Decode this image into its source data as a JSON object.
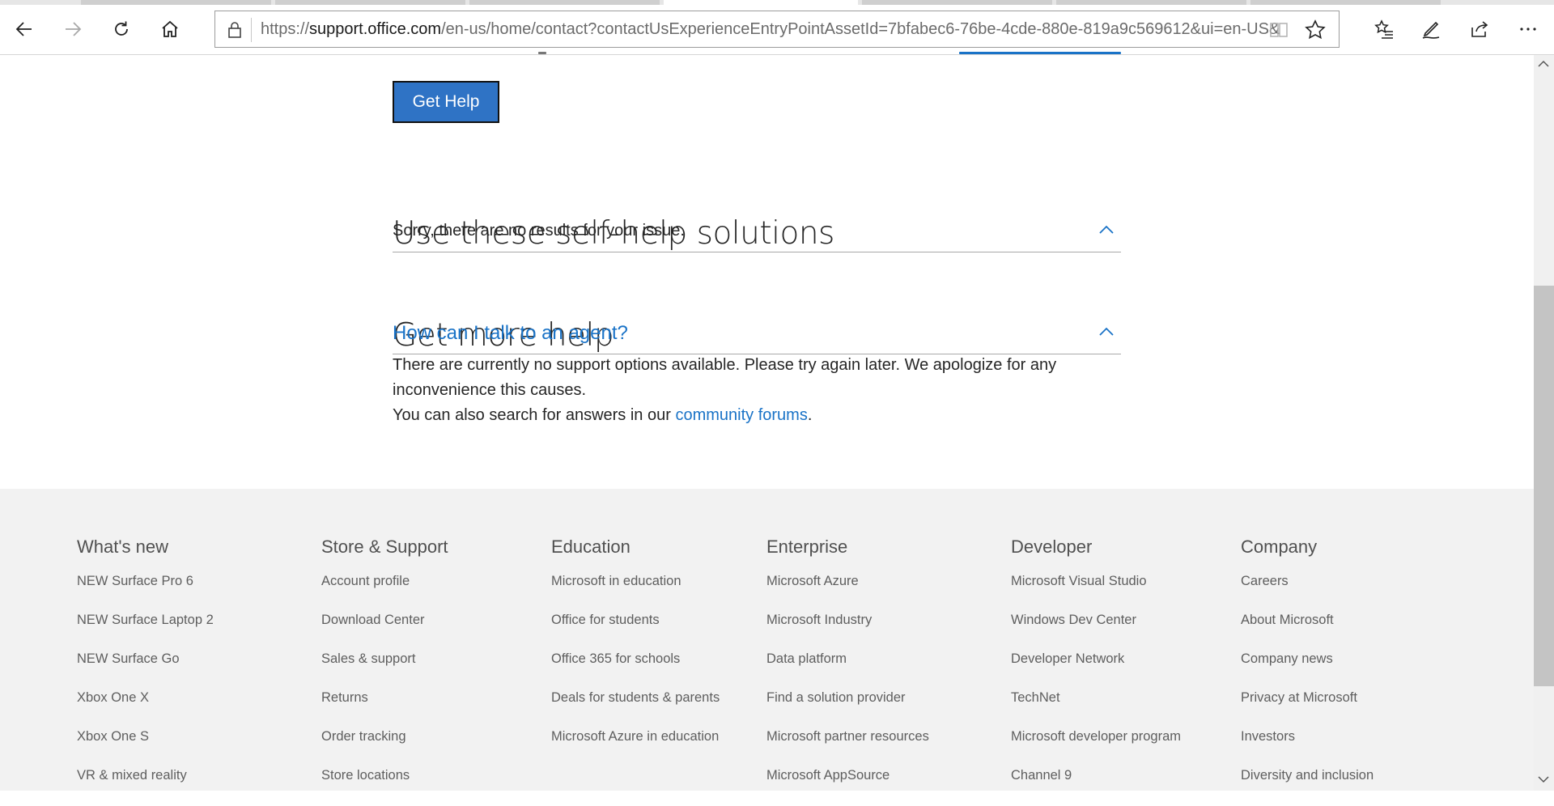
{
  "browser": {
    "url_prefix": "https://",
    "url_host": "support.office.com",
    "url_rest": "/en-us/home/contact?contactUsExperienceEntryPointAssetId=7bfabec6-76be-4cde-880e-819a9c569612&ui=en-US&",
    "icons": [
      "back-arrow-icon",
      "forward-arrow-icon",
      "refresh-icon",
      "home-icon",
      "lock-icon",
      "reading-view-icon",
      "favorite-star-icon",
      "favorites-list-icon",
      "pen-icon",
      "share-icon",
      "more-icon"
    ]
  },
  "main": {
    "get_help_button": "Get Help",
    "self_help": {
      "heading": "Use these self-help solutions",
      "no_results": "Sorry, there are no results for your issue."
    },
    "more_help": {
      "heading": "Get more help",
      "agent_link": "How can I talk to an agent?",
      "no_options_line1": "There are currently no support options available. Please try again later. We apologize for any",
      "no_options_line2": "inconvenience this causes.",
      "search_prefix": "You can also search for answers in our ",
      "forums_link": "community forums",
      "search_suffix": "."
    }
  },
  "footer": {
    "columns": [
      {
        "title": "What's new",
        "items": [
          "NEW Surface Pro 6",
          "NEW Surface Laptop 2",
          "NEW Surface Go",
          "Xbox One X",
          "Xbox One S",
          "VR & mixed reality"
        ]
      },
      {
        "title": "Store & Support",
        "items": [
          "Account profile",
          "Download Center",
          "Sales & support",
          "Returns",
          "Order tracking",
          "Store locations"
        ]
      },
      {
        "title": "Education",
        "items": [
          "Microsoft in education",
          "Office for students",
          "Office 365 for schools",
          "Deals for students & parents",
          "Microsoft Azure in education"
        ]
      },
      {
        "title": "Enterprise",
        "items": [
          "Microsoft Azure",
          "Microsoft Industry",
          "Data platform",
          "Find a solution provider",
          "Microsoft partner resources",
          "Microsoft AppSource"
        ]
      },
      {
        "title": "Developer",
        "items": [
          "Microsoft Visual Studio",
          "Windows Dev Center",
          "Developer Network",
          "TechNet",
          "Microsoft developer program",
          "Channel 9"
        ]
      },
      {
        "title": "Company",
        "items": [
          "Careers",
          "About Microsoft",
          "Company news",
          "Privacy at Microsoft",
          "Investors",
          "Diversity and inclusion"
        ]
      }
    ]
  },
  "colors": {
    "accent": "#2f73c5",
    "link": "#1a73c7",
    "footer_bg": "#f2f2f2"
  }
}
